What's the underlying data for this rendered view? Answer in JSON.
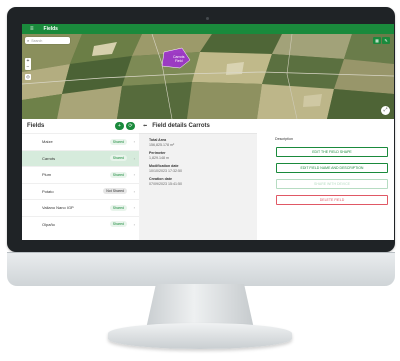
{
  "header": {
    "menu_icon": "hamburger-icon",
    "title": "Fields"
  },
  "map": {
    "search_placeholder": "Search",
    "zoom_in": "+",
    "zoom_out": "−",
    "field_label_line1": "Carrots",
    "field_label_line2": "Field",
    "colors": {
      "highlight": "#a02bd6",
      "green": "#1a8a3c"
    }
  },
  "fields": {
    "title": "Fields",
    "items": [
      {
        "name": "Maize",
        "status": "Shared"
      },
      {
        "name": "Carrots",
        "status": "Shared"
      },
      {
        "name": "Plum",
        "status": "Shared"
      },
      {
        "name": "Potato",
        "status": "Not Shared"
      },
      {
        "name": "Valiano Nano IGP",
        "status": "Shared"
      },
      {
        "name": "Olpaño",
        "status": "Shared"
      }
    ]
  },
  "details": {
    "title": "Field details Carrots",
    "total_area_label": "Total Area",
    "total_area_value": "156,825.178 m²",
    "perimeter_label": "Perimeter",
    "perimeter_value": "1,829.148 m",
    "modification_label": "Modification date",
    "modification_value": "10/10/2023 17:32:50",
    "creation_label": "Creation date",
    "creation_value": "07/09/2023 15:41:50",
    "description_label": "Description",
    "buttons": {
      "edit_shape": "EDIT THE FIELD SHAPE",
      "edit_name": "EDIT FIELD NAME AND DESCRIPTION",
      "share": "SHARE WITH DEVICE",
      "delete": "DELETE FIELD"
    }
  }
}
